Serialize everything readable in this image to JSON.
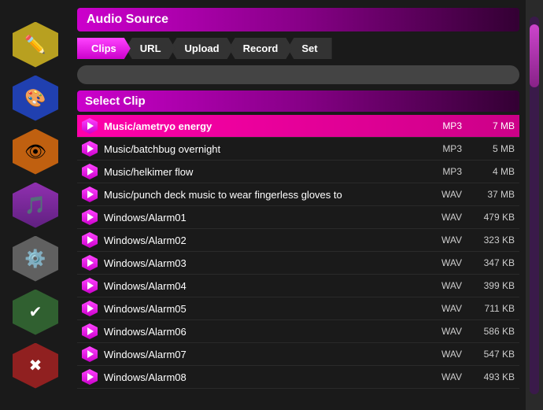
{
  "sidebar": {
    "buttons": [
      {
        "id": "pencil",
        "icon": "✏️",
        "color": "hex-yellow",
        "label": "edit-icon"
      },
      {
        "id": "palette",
        "icon": "🎨",
        "color": "hex-blue",
        "label": "palette-icon"
      },
      {
        "id": "eye",
        "icon": "👁",
        "color": "hex-orange",
        "label": "eye-icon"
      },
      {
        "id": "music",
        "icon": "🎵",
        "color": "hex-purple",
        "label": "music-icon"
      },
      {
        "id": "gear",
        "icon": "⚙️",
        "color": "hex-gray",
        "label": "gear-icon"
      },
      {
        "id": "check",
        "icon": "✔",
        "color": "hex-green",
        "label": "check-icon"
      },
      {
        "id": "close",
        "icon": "✖",
        "color": "hex-red",
        "label": "close-icon"
      }
    ]
  },
  "header": {
    "audio_source_label": "Audio Source",
    "select_clip_label": "Select Clip"
  },
  "tabs": [
    {
      "id": "clips",
      "label": "Clips",
      "active": true
    },
    {
      "id": "url",
      "label": "URL",
      "active": false
    },
    {
      "id": "upload",
      "label": "Upload",
      "active": false
    },
    {
      "id": "record",
      "label": "Record",
      "active": false
    },
    {
      "id": "set",
      "label": "Set",
      "active": false
    }
  ],
  "clips": [
    {
      "name": "Music/ametryo energy",
      "format": "MP3",
      "size": "7 MB",
      "active": true
    },
    {
      "name": "Music/batchbug overnight",
      "format": "MP3",
      "size": "5 MB",
      "active": false
    },
    {
      "name": "Music/helkimer flow",
      "format": "MP3",
      "size": "4 MB",
      "active": false
    },
    {
      "name": "Music/punch deck music to wear fingerless gloves to",
      "format": "WAV",
      "size": "37 MB",
      "active": false
    },
    {
      "name": "Windows/Alarm01",
      "format": "WAV",
      "size": "479 KB",
      "active": false
    },
    {
      "name": "Windows/Alarm02",
      "format": "WAV",
      "size": "323 KB",
      "active": false
    },
    {
      "name": "Windows/Alarm03",
      "format": "WAV",
      "size": "347 KB",
      "active": false
    },
    {
      "name": "Windows/Alarm04",
      "format": "WAV",
      "size": "399 KB",
      "active": false
    },
    {
      "name": "Windows/Alarm05",
      "format": "WAV",
      "size": "711 KB",
      "active": false
    },
    {
      "name": "Windows/Alarm06",
      "format": "WAV",
      "size": "586 KB",
      "active": false
    },
    {
      "name": "Windows/Alarm07",
      "format": "WAV",
      "size": "547 KB",
      "active": false
    },
    {
      "name": "Windows/Alarm08",
      "format": "WAV",
      "size": "493 KB",
      "active": false
    }
  ]
}
